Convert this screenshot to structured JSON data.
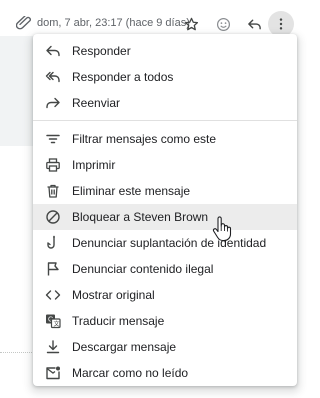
{
  "header": {
    "date": "dom, 7 abr, 23:17 (hace 9 días)",
    "icons": [
      "attachment-icon",
      "star-icon",
      "emoji-icon",
      "reply-icon",
      "more-vert-icon"
    ]
  },
  "menu": {
    "group1": [
      {
        "label": "Responder",
        "icon": "reply-icon"
      },
      {
        "label": "Responder a todos",
        "icon": "reply-all-icon"
      },
      {
        "label": "Reenviar",
        "icon": "forward-icon"
      }
    ],
    "group2": [
      {
        "label": "Filtrar mensajes como este",
        "icon": "filter-icon"
      },
      {
        "label": "Imprimir",
        "icon": "print-icon"
      },
      {
        "label": "Eliminar este mensaje",
        "icon": "trash-icon"
      },
      {
        "label": "Bloquear a Steven Brown",
        "icon": "block-icon"
      },
      {
        "label": "Denunciar suplantación de identidad",
        "icon": "phishing-hook-icon"
      },
      {
        "label": "Denunciar contenido ilegal",
        "icon": "flag-icon"
      },
      {
        "label": "Mostrar original",
        "icon": "code-icon"
      },
      {
        "label": "Traducir mensaje",
        "icon": "translate-icon"
      },
      {
        "label": "Descargar mensaje",
        "icon": "download-icon"
      },
      {
        "label": "Marcar como no leído",
        "icon": "mark-unread-icon"
      }
    ]
  },
  "colors": {
    "hover": "#ececec",
    "icon": "#444746",
    "muted": "#5f6368"
  }
}
